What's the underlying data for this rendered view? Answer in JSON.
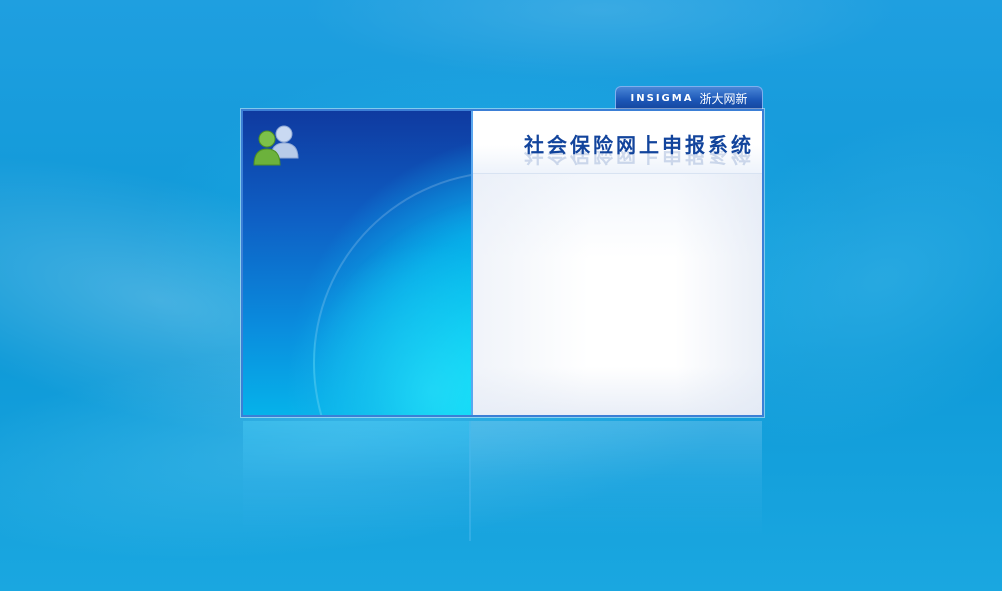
{
  "brand": {
    "logo_text": "INSIGMA",
    "company_name": "浙大网新"
  },
  "login_window": {
    "system_title": "社会保险网上申报系统",
    "icon": "users-icon"
  },
  "colors": {
    "desktop_blue": "#129ad9",
    "panel_dark_blue": "#0f3aa0",
    "panel_cyan": "#06b2ea",
    "title_blue": "#12449c",
    "border_blue": "#3b7fd6"
  }
}
